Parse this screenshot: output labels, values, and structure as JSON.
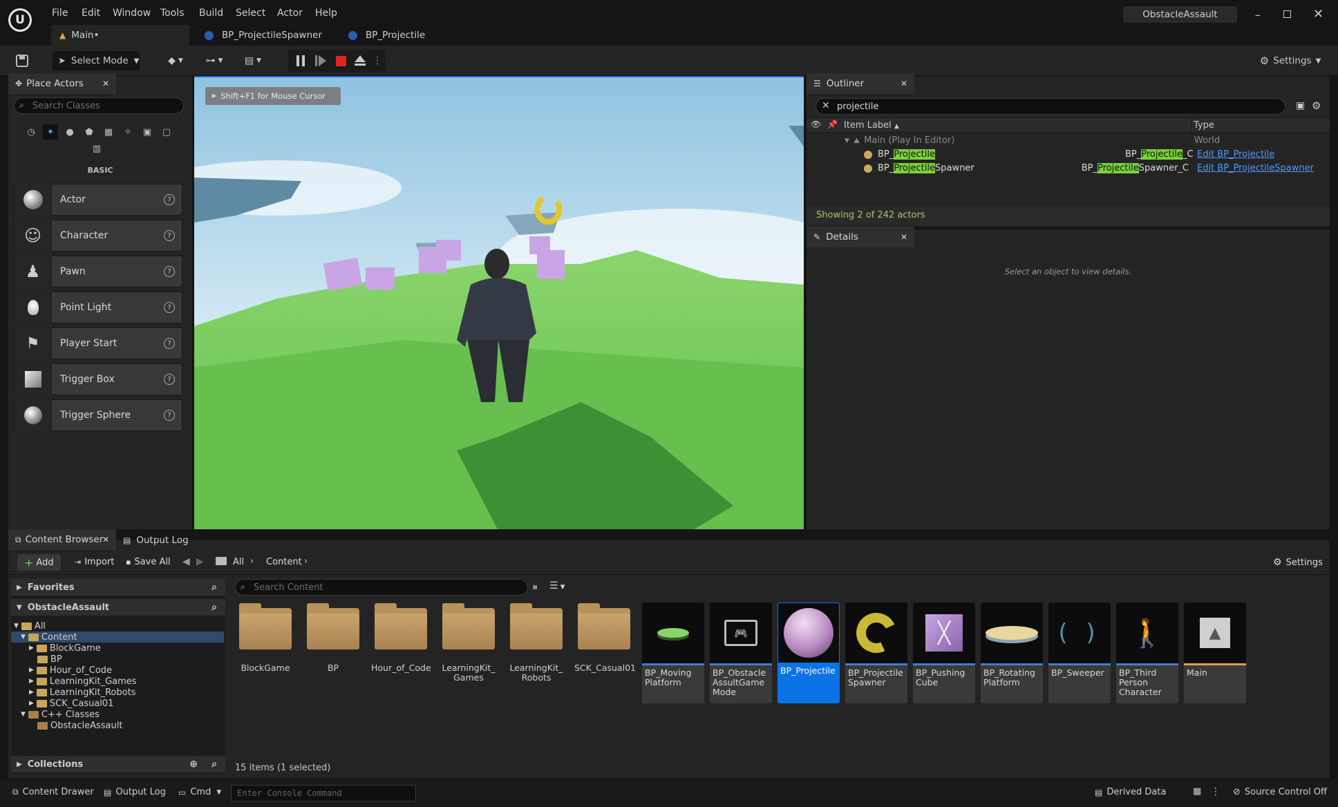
{
  "app": {
    "project_name": "ObstacleAssault"
  },
  "menu": [
    "File",
    "Edit",
    "Window",
    "Tools",
    "Build",
    "Select",
    "Actor",
    "Help"
  ],
  "doc_tabs": [
    {
      "label": "Main•"
    },
    {
      "label": "BP_ProjectileSpawner"
    },
    {
      "label": "BP_Projectile"
    }
  ],
  "toolbar": {
    "select_mode": "Select Mode",
    "settings": "Settings"
  },
  "place_actors": {
    "tab_label": "Place Actors",
    "search_placeholder": "Search Classes",
    "section_label": "BASIC",
    "items": [
      {
        "label": "Actor"
      },
      {
        "label": "Character"
      },
      {
        "label": "Pawn"
      },
      {
        "label": "Point Light"
      },
      {
        "label": "Player Start"
      },
      {
        "label": "Trigger Box"
      },
      {
        "label": "Trigger Sphere"
      }
    ]
  },
  "viewport": {
    "hint": "Shift+F1 for Mouse Cursor"
  },
  "outliner": {
    "tab_label": "Outliner",
    "search_value": "projectile",
    "col_label": "Item Label",
    "col_type": "Type",
    "world_row": {
      "label": "Main (Play In Editor)",
      "type": "World"
    },
    "rows": [
      {
        "pre": "BP_",
        "match": "Projectile",
        "post": "",
        "type_pre": "BP_",
        "type_match": "Projectile",
        "type_post": "_C",
        "link": "Edit BP_Projectile"
      },
      {
        "pre": "BP_",
        "match": "Projectile",
        "post": "Spawner",
        "type_pre": "BP_",
        "type_match": "Projectile",
        "type_post": "Spawner_C",
        "link": "Edit BP_ProjectileSpawner"
      }
    ],
    "footer": "Showing 2 of 242 actors"
  },
  "details": {
    "tab_label": "Details",
    "empty_text": "Select an object to view details."
  },
  "content_browser": {
    "tab_label": "Content Browser",
    "output_tab_label": "Output Log",
    "add": "Add",
    "import": "Import",
    "save_all": "Save All",
    "breadcrumb": [
      "All",
      "Content"
    ],
    "settings": "Settings",
    "favorites": "Favorites",
    "project": "ObstacleAssault",
    "collections": "Collections",
    "search_placeholder": "Search Content",
    "tree": [
      {
        "label": "All"
      },
      {
        "label": "Content"
      },
      {
        "label": "BlockGame"
      },
      {
        "label": "BP"
      },
      {
        "label": "Hour_of_Code"
      },
      {
        "label": "LearningKit_Games"
      },
      {
        "label": "LearningKit_Robots"
      },
      {
        "label": "SCK_Casual01"
      },
      {
        "label": "C++ Classes"
      },
      {
        "label": "ObstacleAssault"
      }
    ],
    "folders": [
      {
        "label": "BlockGame"
      },
      {
        "label": "BP"
      },
      {
        "label": "Hour_of_Code"
      },
      {
        "label": "LearningKit_\nGames"
      },
      {
        "label": "LearningKit_\nRobots"
      },
      {
        "label": "SCK_Casual01"
      }
    ],
    "assets": [
      {
        "label": "BP_Moving Platform"
      },
      {
        "label": "BP_Obstacle AssultGame Mode"
      },
      {
        "label": "BP_Projectile"
      },
      {
        "label": "BP_Projectile Spawner"
      },
      {
        "label": "BP_Pushing Cube"
      },
      {
        "label": "BP_Rotating Platform"
      },
      {
        "label": "BP_Sweeper"
      },
      {
        "label": "BP_Third Person Character"
      },
      {
        "label": "Main"
      }
    ],
    "item_count": "15 items (1 selected)"
  },
  "statusbar": {
    "content_drawer": "Content Drawer",
    "output_log": "Output Log",
    "cmd": "Cmd",
    "console_placeholder": "Enter Console Command",
    "derived_data": "Derived Data",
    "source_control": "Source Control Off"
  },
  "colors": {
    "accent": "#0a74e6",
    "highlight": "#7bd13a",
    "link": "#4d9bff",
    "stop": "#e02424"
  }
}
